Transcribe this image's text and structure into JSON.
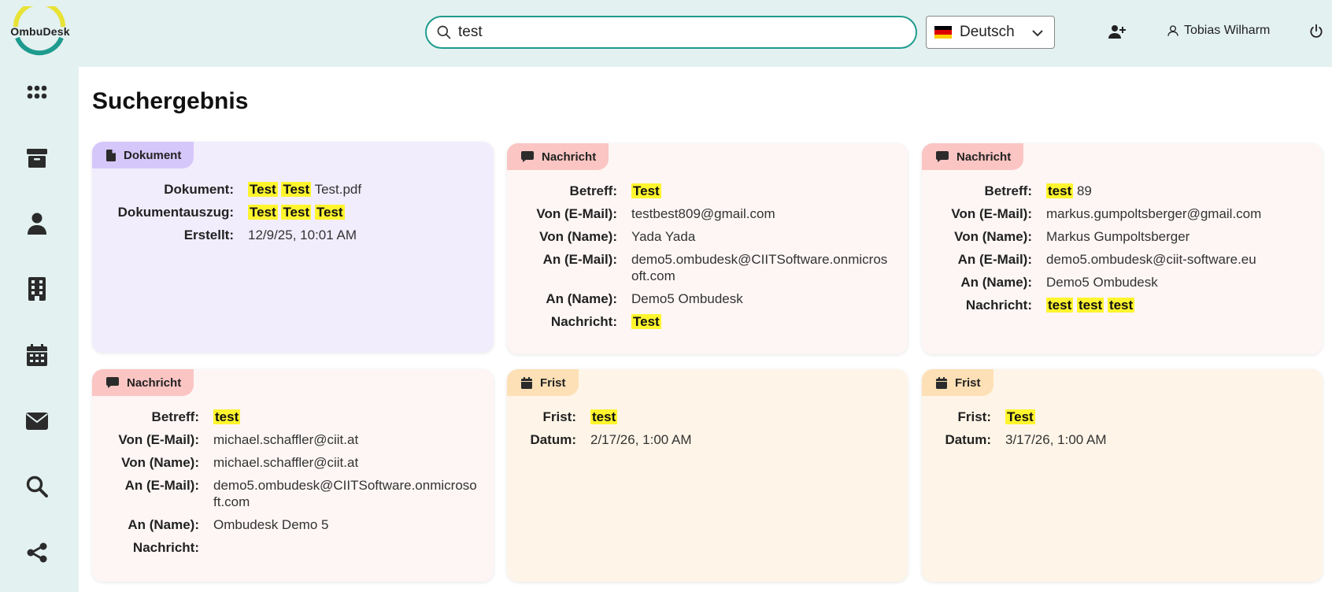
{
  "app": {
    "logo_text": "OmbuDesk"
  },
  "search": {
    "value": "test",
    "placeholder": ""
  },
  "language": {
    "selected": "Deutsch"
  },
  "user": {
    "name": "Tobias Wilharm"
  },
  "sidebar": {
    "items": [
      {
        "name": "dashboard",
        "icon": "grid-icon"
      },
      {
        "name": "archive",
        "icon": "archive-icon"
      },
      {
        "name": "persons",
        "icon": "person-icon"
      },
      {
        "name": "organizations",
        "icon": "building-icon"
      },
      {
        "name": "calendar",
        "icon": "calendar-icon"
      },
      {
        "name": "mail",
        "icon": "envelope-icon"
      },
      {
        "name": "search",
        "icon": "search-icon"
      },
      {
        "name": "share",
        "icon": "share-icon"
      }
    ]
  },
  "page": {
    "title": "Suchergebnis"
  },
  "colors": {
    "accent": "#1e9b8e",
    "highlight": "#fff52e",
    "doc_badge": "#d6c7fb",
    "msg_badge": "#fbc5c3",
    "frist_badge": "#fde0b6"
  },
  "results": [
    {
      "type": "Dokument",
      "icon": "document-icon",
      "fields": [
        {
          "label": "Dokument:",
          "parts": [
            [
              "Test",
              true
            ],
            [
              "Test",
              true
            ],
            [
              "Test.pdf",
              false
            ]
          ]
        },
        {
          "label": "Dokumentauszug:",
          "parts": [
            [
              "Test",
              true
            ],
            [
              "Test",
              true
            ],
            [
              "Test",
              true
            ]
          ]
        },
        {
          "label": "Erstellt:",
          "parts": [
            [
              "12/9/25, 10:01 AM",
              false
            ]
          ]
        }
      ]
    },
    {
      "type": "Nachricht",
      "icon": "message-icon",
      "fields": [
        {
          "label": "Betreff:",
          "parts": [
            [
              "Test",
              true
            ]
          ]
        },
        {
          "label": "Von (E-Mail):",
          "parts": [
            [
              "testbest809@gmail.com",
              false
            ]
          ]
        },
        {
          "label": "Von (Name):",
          "parts": [
            [
              "Yada Yada",
              false
            ]
          ]
        },
        {
          "label": "An (E-Mail):",
          "parts": [
            [
              "demo5.ombudesk@CIITSoftware.onmicrosoft.com",
              false
            ]
          ]
        },
        {
          "label": "An (Name):",
          "parts": [
            [
              "Demo5 Ombudesk",
              false
            ]
          ]
        },
        {
          "label": "Nachricht:",
          "parts": [
            [
              "Test",
              true
            ]
          ]
        }
      ]
    },
    {
      "type": "Nachricht",
      "icon": "message-icon",
      "fields": [
        {
          "label": "Betreff:",
          "parts": [
            [
              "test",
              true
            ],
            [
              "89",
              false
            ]
          ]
        },
        {
          "label": "Von (E-Mail):",
          "parts": [
            [
              "markus.gumpoltsberger@gmail.com",
              false
            ]
          ]
        },
        {
          "label": "Von (Name):",
          "parts": [
            [
              "Markus Gumpoltsberger",
              false
            ]
          ]
        },
        {
          "label": "An (E-Mail):",
          "parts": [
            [
              "demo5.ombudesk@ciit-software.eu",
              false
            ]
          ]
        },
        {
          "label": "An (Name):",
          "parts": [
            [
              "Demo5 Ombudesk",
              false
            ]
          ]
        },
        {
          "label": "Nachricht:",
          "parts": [
            [
              "test",
              true
            ],
            [
              "test",
              true
            ],
            [
              "test",
              true
            ]
          ]
        }
      ]
    },
    {
      "type": "Nachricht",
      "icon": "message-icon",
      "fields": [
        {
          "label": "Betreff:",
          "parts": [
            [
              "test",
              true
            ]
          ]
        },
        {
          "label": "Von (E-Mail):",
          "parts": [
            [
              "michael.schaffler@ciit.at",
              false
            ]
          ]
        },
        {
          "label": "Von (Name):",
          "parts": [
            [
              "michael.schaffler@ciit.at",
              false
            ]
          ]
        },
        {
          "label": "An (E-Mail):",
          "parts": [
            [
              "demo5.ombudesk@CIITSoftware.onmicrosoft.com",
              false
            ]
          ]
        },
        {
          "label": "An (Name):",
          "parts": [
            [
              "Ombudesk Demo 5",
              false
            ]
          ]
        },
        {
          "label": "Nachricht:",
          "parts": []
        }
      ]
    },
    {
      "type": "Frist",
      "icon": "calendar-icon",
      "fields": [
        {
          "label": "Frist:",
          "parts": [
            [
              "test",
              true
            ]
          ]
        },
        {
          "label": "Datum:",
          "parts": [
            [
              "2/17/26, 1:00 AM",
              false
            ]
          ]
        }
      ]
    },
    {
      "type": "Frist",
      "icon": "calendar-icon",
      "fields": [
        {
          "label": "Frist:",
          "parts": [
            [
              "Test",
              true
            ]
          ]
        },
        {
          "label": "Datum:",
          "parts": [
            [
              "3/17/26, 1:00 AM",
              false
            ]
          ]
        }
      ]
    }
  ]
}
